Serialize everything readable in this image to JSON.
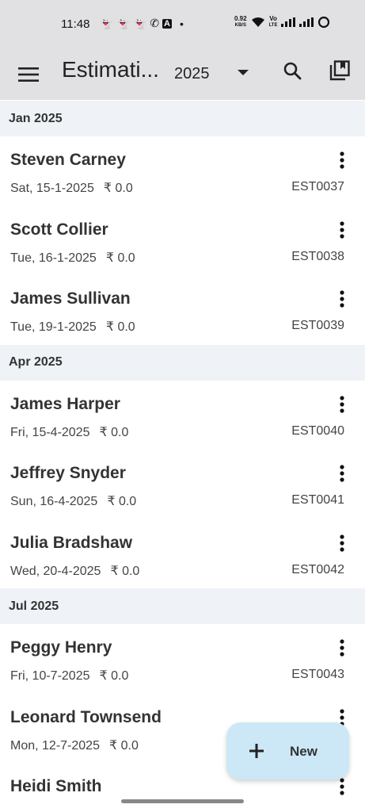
{
  "status": {
    "time": "11:48",
    "net_speed_top": "0.92",
    "net_speed_bottom": "KB/S",
    "volte_top": "Vo",
    "volte_bottom": "LTE"
  },
  "app_bar": {
    "title": "Estimati...",
    "year": "2025"
  },
  "sections": [
    {
      "header": "Jan 2025",
      "rows": [
        {
          "name": "Steven Carney",
          "date": "Sat, 15-1-2025",
          "amount": "₹ 0.0",
          "code": "EST0037"
        },
        {
          "name": "Scott Collier",
          "date": "Tue, 16-1-2025",
          "amount": "₹ 0.0",
          "code": "EST0038"
        },
        {
          "name": "James Sullivan",
          "date": "Tue, 19-1-2025",
          "amount": "₹ 0.0",
          "code": "EST0039"
        }
      ]
    },
    {
      "header": "Apr 2025",
      "rows": [
        {
          "name": "James Harper",
          "date": "Fri, 15-4-2025",
          "amount": "₹ 0.0",
          "code": "EST0040"
        },
        {
          "name": "Jeffrey Snyder",
          "date": "Sun, 16-4-2025",
          "amount": "₹ 0.0",
          "code": "EST0041"
        },
        {
          "name": "Julia Bradshaw",
          "date": "Wed, 20-4-2025",
          "amount": "₹ 0.0",
          "code": "EST0042"
        }
      ]
    },
    {
      "header": "Jul 2025",
      "rows": [
        {
          "name": "Peggy Henry",
          "date": "Fri, 10-7-2025",
          "amount": "₹ 0.0",
          "code": "EST0043"
        },
        {
          "name": "Leonard Townsend",
          "date": "Mon, 12-7-2025",
          "amount": "₹ 0.0",
          "code": ""
        },
        {
          "name": "Heidi Smith",
          "date": "",
          "amount": "",
          "code": ""
        }
      ]
    }
  ],
  "fab": {
    "label": "New"
  },
  "colors": {
    "app_bar_bg": "#e1e1e3",
    "section_bg": "#eff2f7",
    "fab_bg": "#cce8f6"
  }
}
